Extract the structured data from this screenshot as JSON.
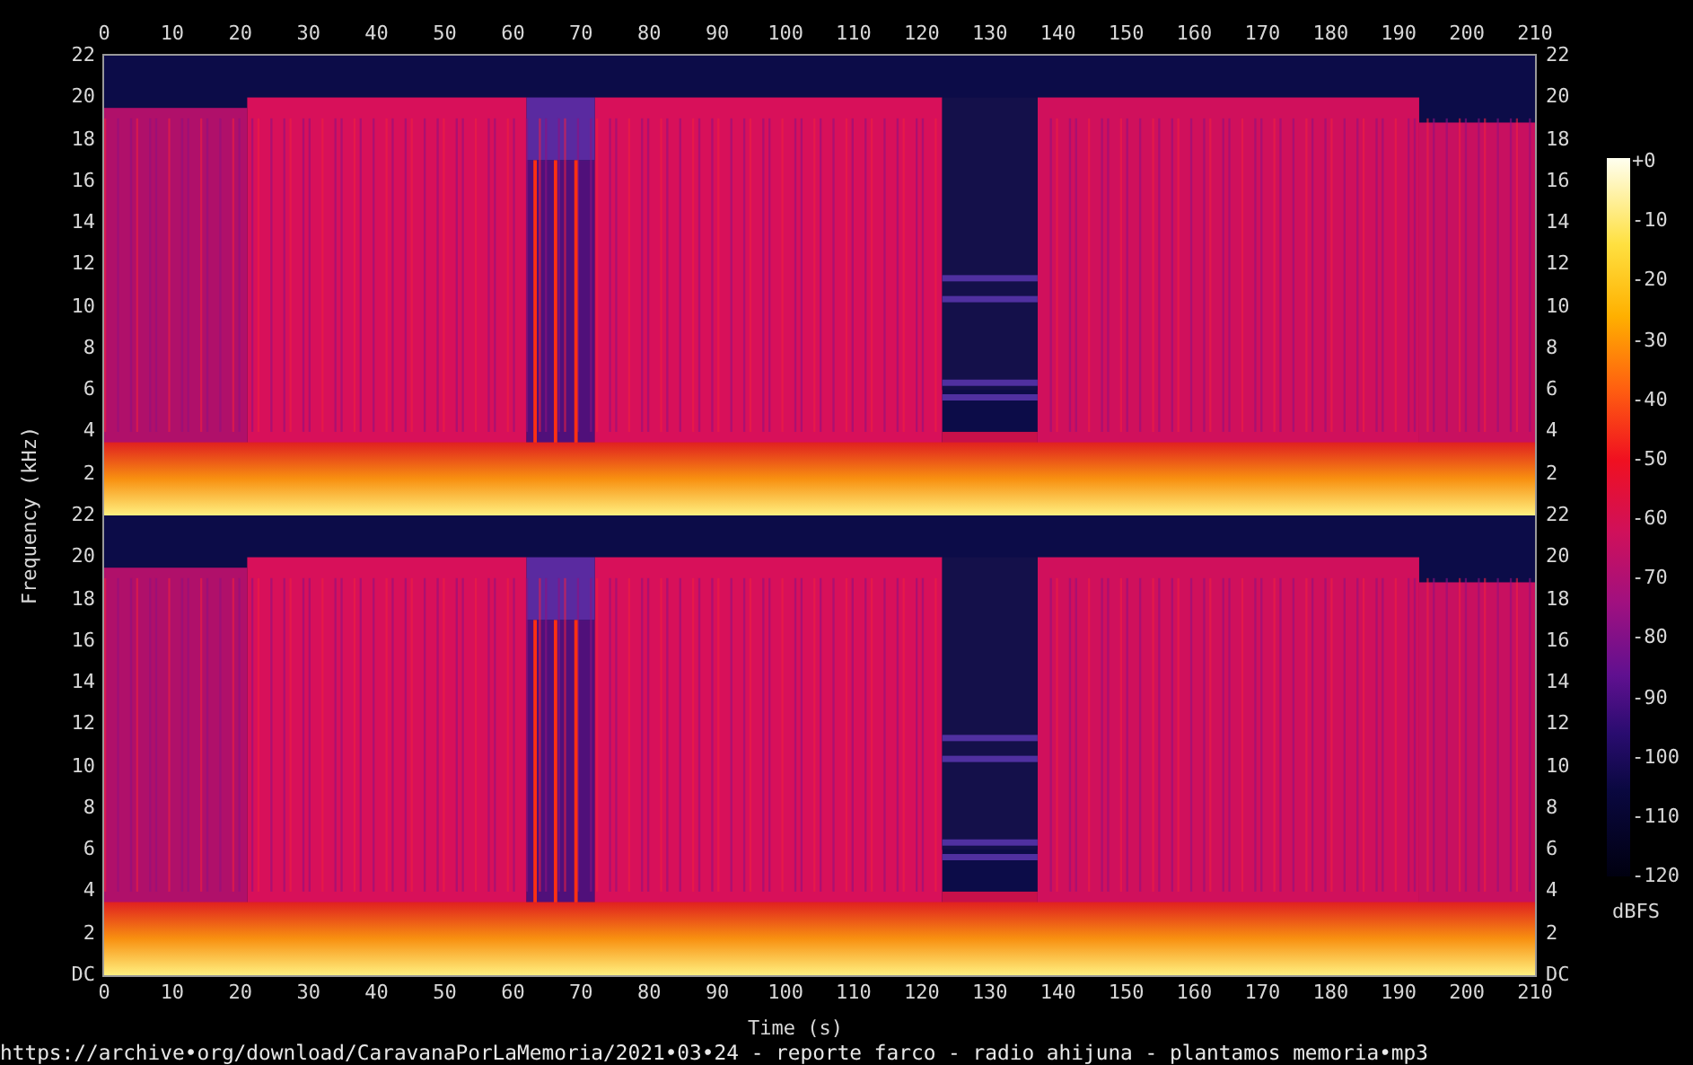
{
  "x_axis": {
    "label": "Time (s)",
    "top_ticks": [
      "0",
      "10",
      "20",
      "30",
      "40",
      "50",
      "60",
      "70",
      "80",
      "90",
      "100",
      "110",
      "120",
      "130",
      "140",
      "150",
      "160",
      "170",
      "180",
      "190",
      "200",
      "210"
    ],
    "bottom_ticks": [
      "0",
      "10",
      "20",
      "30",
      "40",
      "50",
      "60",
      "70",
      "80",
      "90",
      "100",
      "110",
      "120",
      "130",
      "140",
      "150",
      "160",
      "170",
      "180",
      "190",
      "200",
      "210"
    ]
  },
  "y_axis": {
    "label": "Frequency (kHz)"
  },
  "channels": [
    {
      "left_ticks": [
        "22",
        "20",
        "18",
        "16",
        "14",
        "12",
        "10",
        "8",
        "6",
        "4",
        "2"
      ],
      "right_ticks": [
        "22",
        "20",
        "18",
        "16",
        "14",
        "12",
        "10",
        "8",
        "6",
        "4",
        "2"
      ]
    },
    {
      "left_ticks": [
        "22",
        "20",
        "18",
        "16",
        "14",
        "12",
        "10",
        "8",
        "6",
        "4",
        "2",
        "DC"
      ],
      "right_ticks": [
        "22",
        "20",
        "18",
        "16",
        "14",
        "12",
        "10",
        "8",
        "6",
        "4",
        "2",
        "DC"
      ]
    }
  ],
  "colorbar": {
    "ticks": [
      "+0",
      "-10",
      "-20",
      "-30",
      "-40",
      "-50",
      "-60",
      "-70",
      "-80",
      "-90",
      "-100",
      "-110",
      "-120"
    ],
    "unit": "dBFS"
  },
  "source_url": "https://archive•org/download/CaravanaPorLaMemoria/2021•03•24 - reporte farco - radio ahijuna - plantamos memoria•mp3"
}
